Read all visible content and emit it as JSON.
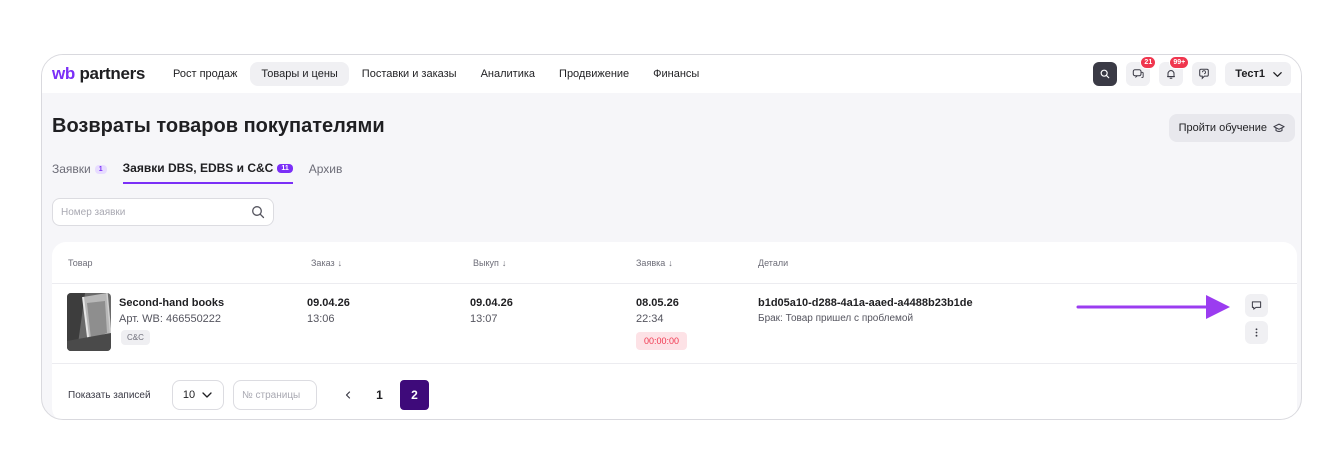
{
  "header": {
    "logo_wb": "wb",
    "logo_partners": "partners",
    "nav": [
      {
        "label": "Рост продаж"
      },
      {
        "label": "Товары и цены"
      },
      {
        "label": "Поставки и заказы"
      },
      {
        "label": "Аналитика"
      },
      {
        "label": "Продвижение"
      },
      {
        "label": "Финансы"
      }
    ],
    "active_nav": "Товары и цены",
    "chat_badge": "21",
    "notif_badge": "99+",
    "user_name": "Тест1",
    "icons": [
      "search-icon",
      "chat-icon",
      "bell-icon",
      "support-icon",
      "chevron-down-icon"
    ]
  },
  "page": {
    "title": "Возвраты товаров покупателями",
    "learn_button": "Пройти обучение",
    "tabs": [
      {
        "label": "Заявки",
        "count": "1"
      },
      {
        "label": "Заявки DBS, EDBS и C&C",
        "count": "11"
      },
      {
        "label": "Архив"
      }
    ],
    "search_placeholder": "Номер заявки"
  },
  "table": {
    "columns": [
      "Товар",
      "Заказ",
      "Выкуп",
      "Заявка",
      "Детали"
    ],
    "rows": [
      {
        "product_name": "Second-hand books",
        "article": "Арт. WB: 466550222",
        "tag": "C&C",
        "order_date": "09.04.26",
        "order_time": "13:06",
        "buyout_date": "09.04.26",
        "buyout_time": "13:07",
        "request_date": "08.05.26",
        "request_time": "22:34",
        "timer": "00:00:00",
        "request_id": "b1d05a10-d288-4a1a-aaed-a4488b23b1de",
        "reason": "Брак: Товар пришел с проблемой"
      }
    ]
  },
  "pagination": {
    "label": "Показать записей",
    "page_size": "10",
    "page_placeholder": "№ страницы",
    "pages": [
      "1",
      "2"
    ],
    "current_page": "2"
  },
  "colors": {
    "brand": "#7b2ff7",
    "active_page": "#3e0a7a",
    "danger": "#f0364e",
    "annotation_arrow": "#9b3cf0"
  }
}
